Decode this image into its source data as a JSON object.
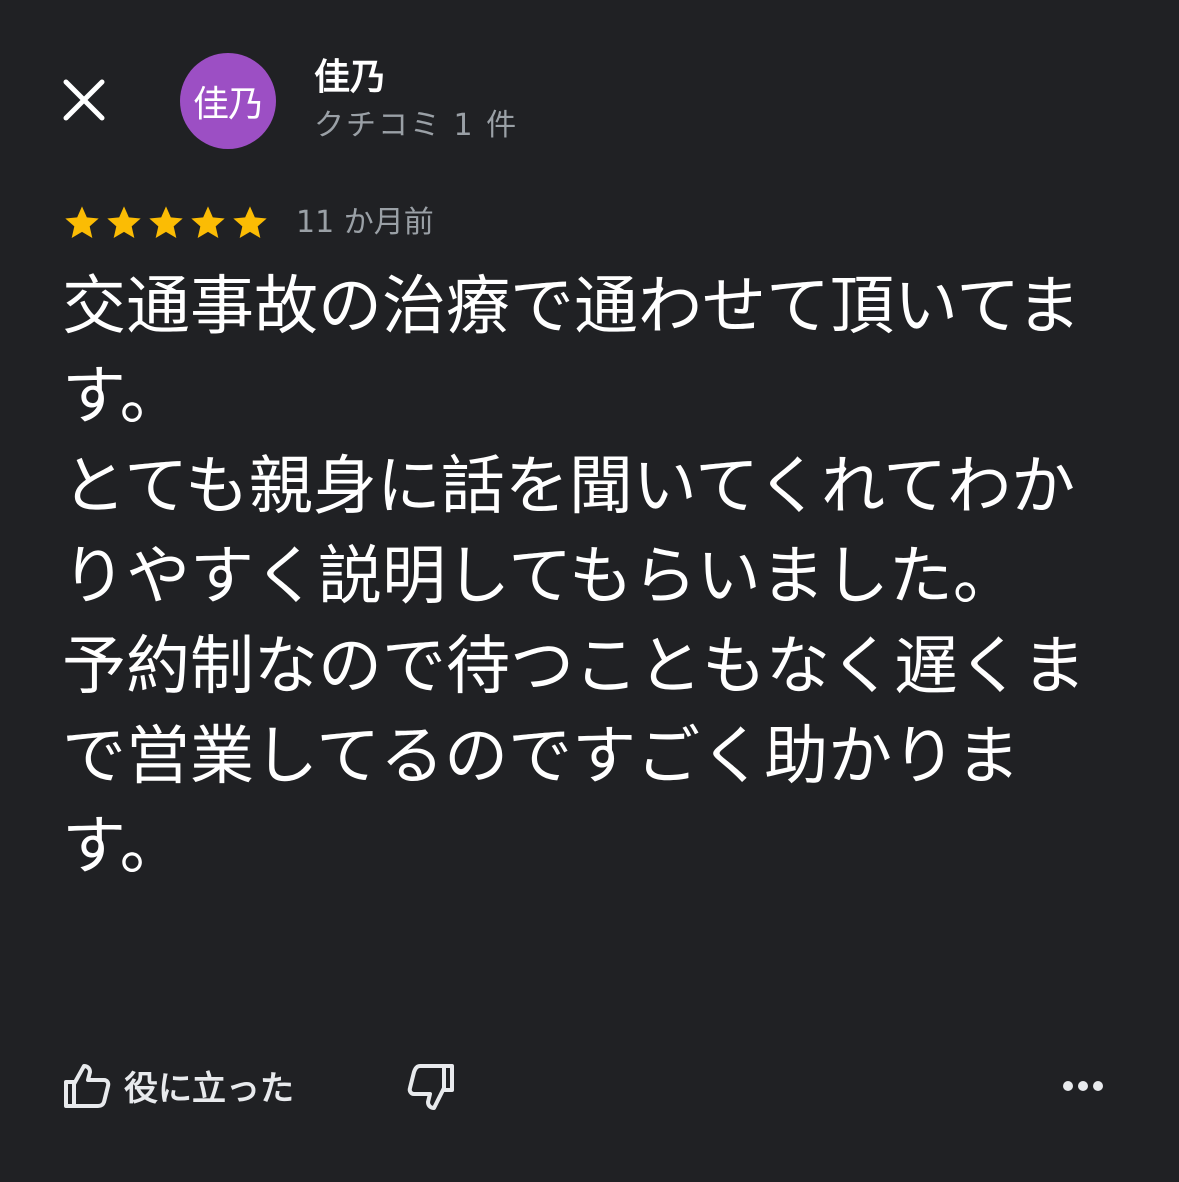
{
  "reviewer": {
    "name": "佳乃",
    "avatar_text": "佳乃",
    "avatar_color": "#9c4fc4",
    "review_count": "クチコミ 1 件"
  },
  "review": {
    "rating": 5,
    "rating_max": 5,
    "star_color": "#fbbc04",
    "date": "11 か月前",
    "text": "交通事故の治療で通わせて頂いてます。\nとても親身に話を聞いてくれてわかりやすく説明してもらいました。\n予約制なので待つこともなく遅くまで営業してるのですごく助かります。"
  },
  "actions": {
    "helpful_label": "役に立った",
    "icons": [
      "close-icon",
      "thumbs-up-icon",
      "thumbs-down-icon",
      "more-icon"
    ]
  }
}
